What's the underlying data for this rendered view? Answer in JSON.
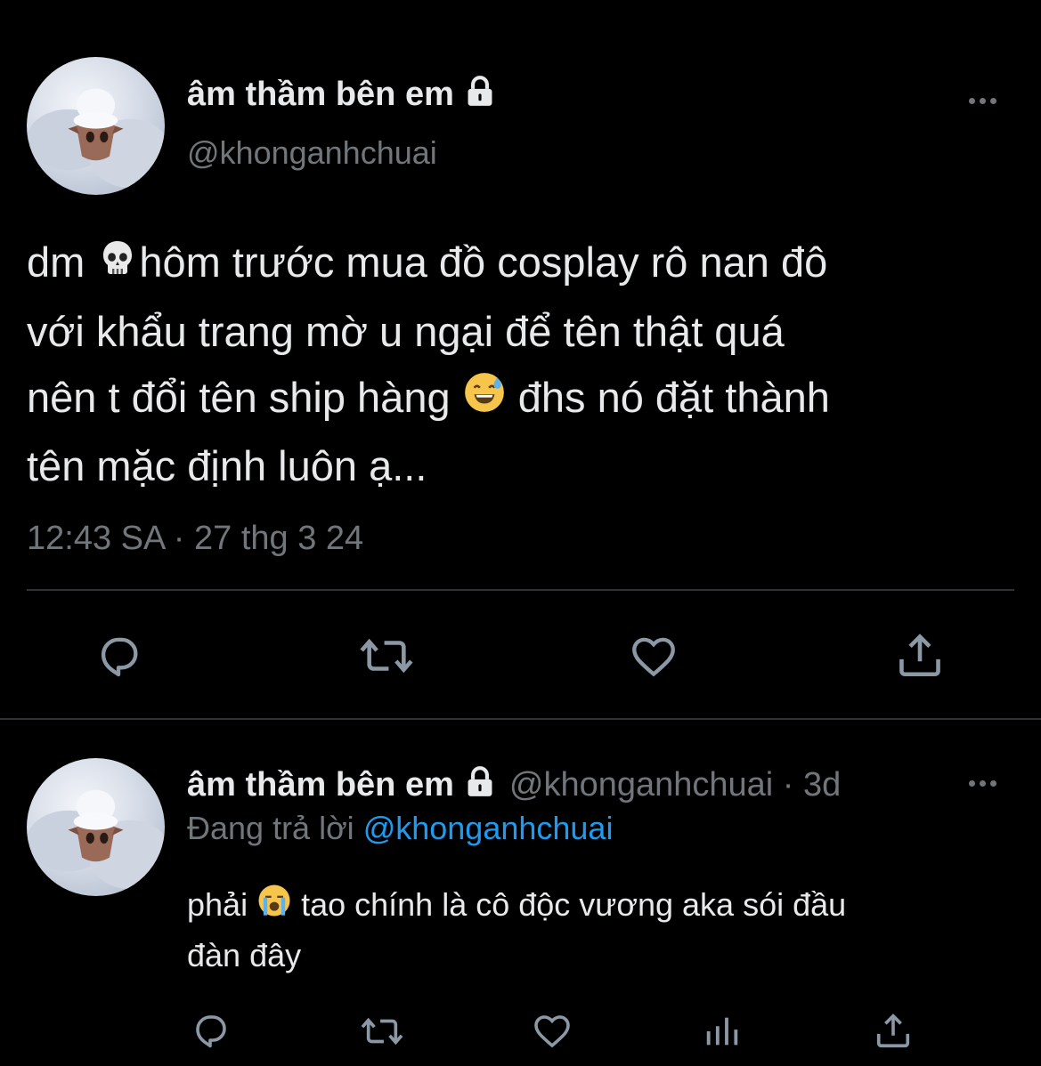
{
  "main_tweet": {
    "display_name": "âm thầm bên em",
    "handle": "@khonganhchuai",
    "text_lines": [
      [
        "dm ",
        "skull-emoji",
        "hôm trước mua đồ cosplay rô nan đô"
      ],
      [
        "với khẩu trang mờ u ngại để tên thật quá"
      ],
      [
        "nên t đổi tên ship hàng ",
        "sweat-smile-emoji",
        " đhs nó đặt thành"
      ],
      [
        "tên mặc định luôn ạ..."
      ]
    ],
    "line1_a": "dm ",
    "line1_b": "hôm trước mua đồ cosplay rô nan đô",
    "line2": "với khẩu trang mờ u ngại để tên thật quá",
    "line3_a": "nên t đổi tên ship hàng ",
    "line3_b": " đhs nó đặt thành",
    "line4": "tên mặc định luôn ạ...",
    "timestamp": "12:43 SA · 27 thg 3 24",
    "actions": [
      "reply-icon",
      "retweet-icon",
      "like-icon",
      "share-icon"
    ]
  },
  "reply_tweet": {
    "display_name": "âm thầm bên em",
    "handle_time": "@khonganhchuai · 3d",
    "replying_prefix": "Đang trả lời ",
    "replying_to": "@khonganhchuai",
    "text_line1_a": "phải ",
    "text_line1_b": "  tao chính là cô độc vương aka sói đầu",
    "text_line2": "đàn đây",
    "actions": [
      "reply-icon",
      "retweet-icon",
      "like-icon",
      "views-icon",
      "share-icon"
    ]
  },
  "colors": {
    "background": "#000000",
    "text": "#e7e9ea",
    "muted": "#71767b",
    "link": "#1d9bf0",
    "divider": "#2f3336"
  }
}
